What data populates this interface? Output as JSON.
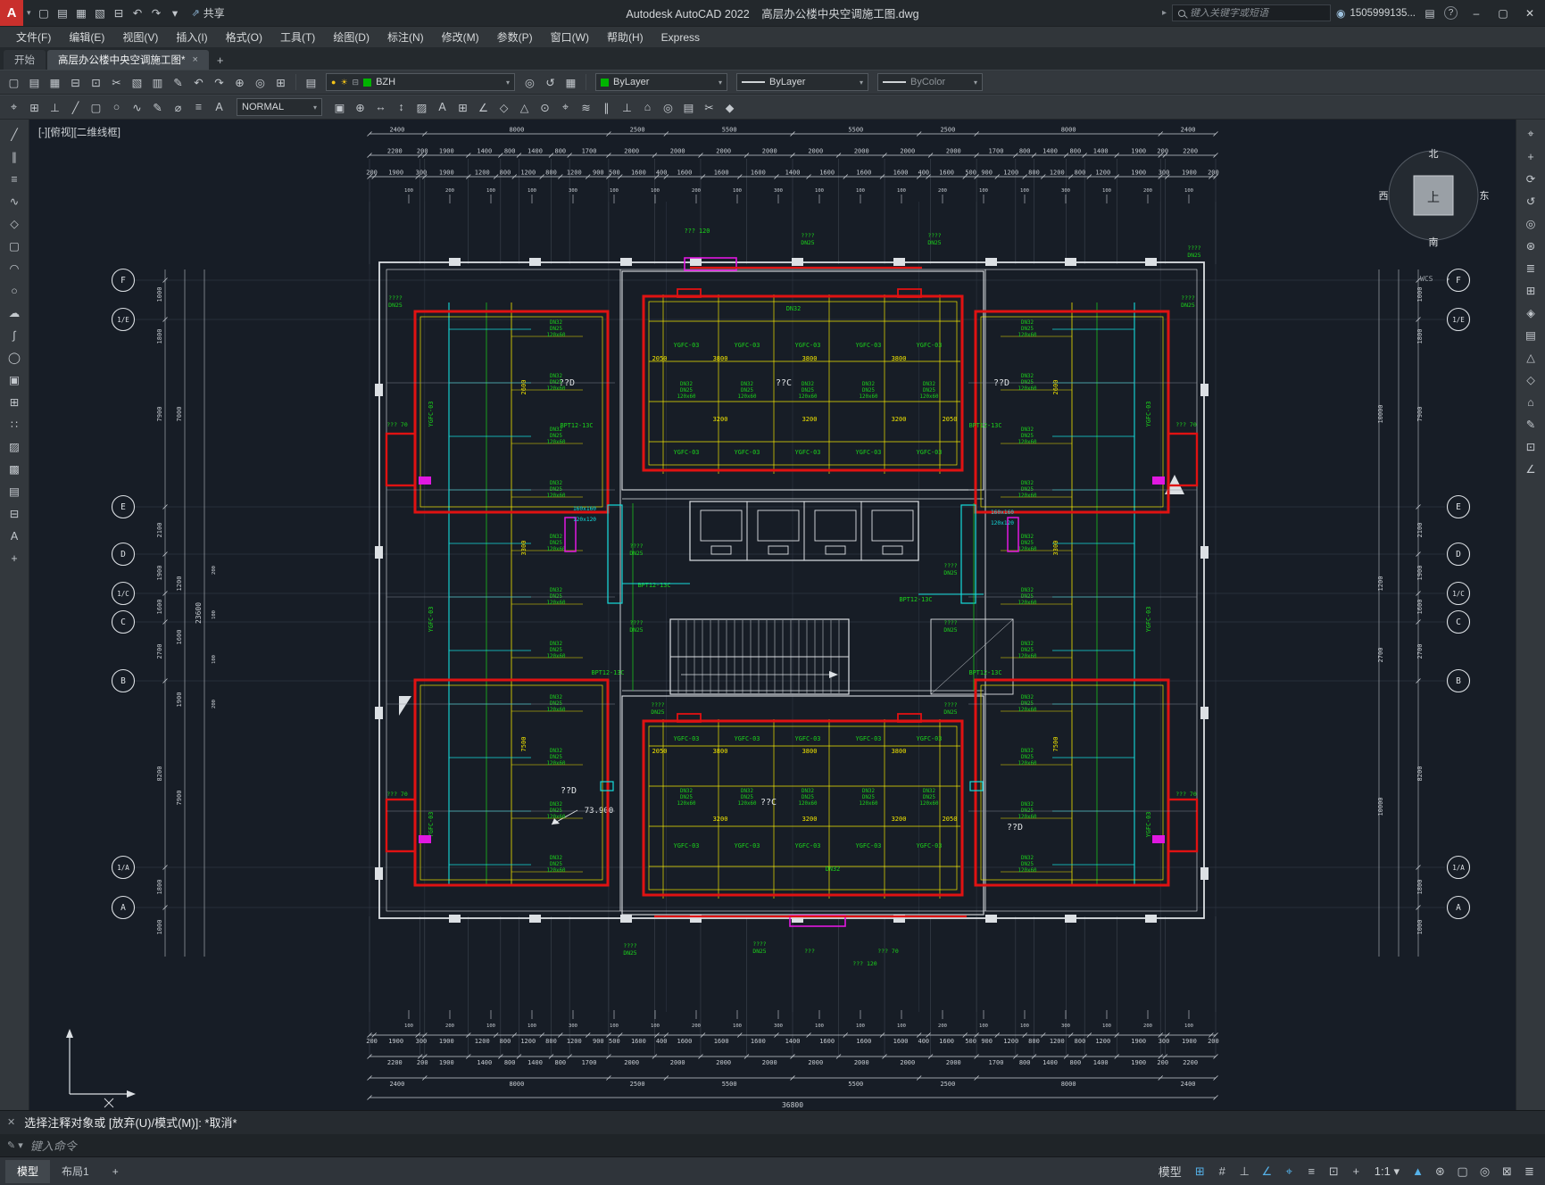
{
  "title_bar": {
    "share": "共享",
    "app_title": "Autodesk AutoCAD 2022",
    "doc_title": "高层办公楼中央空调施工图.dwg",
    "search_placeholder": "键入关键字或短语",
    "account": "1505999135..."
  },
  "menu_items": [
    "文件(F)",
    "编辑(E)",
    "视图(V)",
    "插入(I)",
    "格式(O)",
    "工具(T)",
    "绘图(D)",
    "标注(N)",
    "修改(M)",
    "参数(P)",
    "窗口(W)",
    "帮助(H)",
    "Express"
  ],
  "doc_tabs": {
    "start": "开始",
    "doc": "高层办公楼中央空调施工图*",
    "plus": "+"
  },
  "toolbar": {
    "layer": "BZH",
    "color": "ByLayer",
    "linetype": "ByLayer",
    "lineweight": "ByColor",
    "style": "NORMAL"
  },
  "command_line": {
    "history": "选择注释对象或 [放弃(U)/模式(M)]: *取消*",
    "input": "键入命令"
  },
  "status_bar": {
    "model": "模型",
    "layout1": "布局1",
    "plus": "+"
  },
  "icons": {
    "qat": [
      {
        "n": "new-icon",
        "g": "▢"
      },
      {
        "n": "open-icon",
        "g": "▤"
      },
      {
        "n": "save-icon",
        "g": "▦"
      },
      {
        "n": "saveas-icon",
        "g": "▧"
      },
      {
        "n": "plot-icon",
        "g": "⊟"
      },
      {
        "n": "undo-icon",
        "g": "↶"
      },
      {
        "n": "redo-icon",
        "g": "↷"
      },
      {
        "n": "qat-dropdown-icon",
        "g": "▾"
      }
    ],
    "rowA": [
      {
        "n": "new2-icon",
        "g": "▢"
      },
      {
        "n": "open2-icon",
        "g": "▤"
      },
      {
        "n": "save2-icon",
        "g": "▦"
      },
      {
        "n": "plot2-icon",
        "g": "⊟"
      },
      {
        "n": "preview-icon",
        "g": "⊡"
      },
      {
        "n": "cut-icon",
        "g": "✂"
      },
      {
        "n": "copy-icon",
        "g": "▧"
      },
      {
        "n": "paste-icon",
        "g": "▥"
      },
      {
        "n": "matchprops-icon",
        "g": "✎"
      },
      {
        "n": "undo3-icon",
        "g": "↶"
      },
      {
        "n": "redo3-icon",
        "g": "↷"
      },
      {
        "n": "pan-icon",
        "g": "⊕"
      },
      {
        "n": "zoom-icon",
        "g": "◎"
      },
      {
        "n": "properties-icon",
        "g": "⊞"
      }
    ],
    "layer_pre": [
      {
        "n": "layer-properties-icon",
        "g": "▤"
      }
    ],
    "rowA2": [
      {
        "n": "make-current-icon",
        "g": "◎"
      },
      {
        "n": "layer-previous-icon",
        "g": "↺"
      },
      {
        "n": "layer-state-icon",
        "g": "▦"
      }
    ],
    "rowB_left": [
      {
        "n": "snap-icon",
        "g": "⌖"
      },
      {
        "n": "grid-icon",
        "g": "⊞"
      },
      {
        "n": "ortho-icon",
        "g": "⊥"
      },
      {
        "n": "line-icon",
        "g": "╱"
      },
      {
        "n": "rect-icon",
        "g": "▢"
      },
      {
        "n": "circle-icon",
        "g": "○"
      },
      {
        "n": "spline-icon",
        "g": "∿"
      },
      {
        "n": "edit-icon",
        "g": "✎"
      },
      {
        "n": "diameter-icon",
        "g": "⌀"
      },
      {
        "n": "list-icon",
        "g": "≡"
      },
      {
        "n": "text-icon",
        "g": "A"
      }
    ],
    "rowB_right": [
      {
        "n": "copy2-icon",
        "g": "▣"
      },
      {
        "n": "insert-icon",
        "g": "⊕"
      },
      {
        "n": "stretch-icon",
        "g": "↔"
      },
      {
        "n": "scale-icon",
        "g": "↕"
      },
      {
        "n": "hatch-icon",
        "g": "▨"
      },
      {
        "n": "text2-icon",
        "g": "A"
      },
      {
        "n": "table-icon",
        "g": "⊞"
      },
      {
        "n": "dimension-icon",
        "g": "∠"
      },
      {
        "n": "leader-icon",
        "g": "◇"
      },
      {
        "n": "block-icon",
        "g": "△"
      },
      {
        "n": "point-icon",
        "g": "⊙"
      },
      {
        "n": "osnap2-icon",
        "g": "⌖"
      },
      {
        "n": "polyline2-icon",
        "g": "≋"
      },
      {
        "n": "parallel-icon",
        "g": "∥"
      },
      {
        "n": "perpendicular-icon",
        "g": "⊥"
      },
      {
        "n": "home-icon",
        "g": "⌂"
      },
      {
        "n": "zoom2-icon",
        "g": "◎"
      },
      {
        "n": "props2-icon",
        "g": "▤"
      },
      {
        "n": "trim-icon",
        "g": "✂"
      },
      {
        "n": "erase-icon",
        "g": "◆"
      }
    ],
    "left_col": [
      {
        "n": "line-tool-icon",
        "g": "╱"
      },
      {
        "n": "xline-tool-icon",
        "g": "∥"
      },
      {
        "n": "mline-tool-icon",
        "g": "≡"
      },
      {
        "n": "polyline-tool-icon",
        "g": "∿"
      },
      {
        "n": "polygon-tool-icon",
        "g": "◇"
      },
      {
        "n": "rectangle-tool-icon",
        "g": "▢"
      },
      {
        "n": "arc-tool-icon",
        "g": "◠"
      },
      {
        "n": "circle-tool-icon",
        "g": "○"
      },
      {
        "n": "revcloud-tool-icon",
        "g": "☁"
      },
      {
        "n": "spline-tool-icon",
        "g": "∫"
      },
      {
        "n": "ellipse-tool-icon",
        "g": "◯"
      },
      {
        "n": "insert-block-icon",
        "g": "▣"
      },
      {
        "n": "make-block-icon",
        "g": "⊞"
      },
      {
        "n": "point-tool-icon",
        "g": "∷"
      },
      {
        "n": "hatch-tool-icon",
        "g": "▨"
      },
      {
        "n": "gradient-tool-icon",
        "g": "▩"
      },
      {
        "n": "region-tool-icon",
        "g": "▤"
      },
      {
        "n": "table-tool-icon",
        "g": "⊟"
      },
      {
        "n": "mtext-tool-icon",
        "g": "A"
      },
      {
        "n": "divide-tool-icon",
        "g": "+"
      }
    ],
    "right_col": [
      {
        "n": "measure-icon",
        "g": "⌖"
      },
      {
        "n": "move-icon",
        "g": "+"
      },
      {
        "n": "rotate-icon",
        "g": "⟳"
      },
      {
        "n": "undo2-icon",
        "g": "↺"
      },
      {
        "n": "zoom3-icon",
        "g": "◎"
      },
      {
        "n": "pan2-icon",
        "g": "⊛"
      },
      {
        "n": "layers3-icon",
        "g": "≣"
      },
      {
        "n": "grid2-icon",
        "g": "⊞"
      },
      {
        "n": "gem-icon",
        "g": "◈"
      },
      {
        "n": "sheet-icon",
        "g": "▤"
      },
      {
        "n": "up-icon",
        "g": "△"
      },
      {
        "n": "diamond-icon",
        "g": "◇"
      },
      {
        "n": "home2-icon",
        "g": "⌂"
      },
      {
        "n": "annotate-icon",
        "g": "✎"
      },
      {
        "n": "box-icon",
        "g": "⊡"
      },
      {
        "n": "angle-icon",
        "g": "∠"
      }
    ],
    "status_right": [
      {
        "n": "model-space-button",
        "g": "模型",
        "t": 1
      },
      {
        "n": "grid-toggle-icon",
        "g": "⊞",
        "b": 1
      },
      {
        "n": "snap-toggle-icon",
        "g": "#"
      },
      {
        "n": "ortho-toggle-icon",
        "g": "⊥"
      },
      {
        "n": "polar-toggle-icon",
        "g": "∠",
        "b": 1
      },
      {
        "n": "osnap-toggle-icon",
        "g": "⌖",
        "b": 1
      },
      {
        "n": "lineweight-toggle-icon",
        "g": "≡"
      },
      {
        "n": "transparency-toggle-icon",
        "g": "⊡"
      },
      {
        "n": "dynamic-input-icon",
        "g": "+"
      },
      {
        "n": "scale-display",
        "g": "1:1 ▾",
        "t": 1
      },
      {
        "n": "annotation-scale-icon",
        "g": "▲",
        "b": 1
      },
      {
        "n": "workspace-gear-icon",
        "g": "⊛"
      },
      {
        "n": "units-icon",
        "g": "▢"
      },
      {
        "n": "quick-search-icon",
        "g": "◎"
      },
      {
        "n": "fullscreen-icon",
        "g": "⊠"
      },
      {
        "n": "customize-icon",
        "g": "≣"
      }
    ]
  },
  "drawing": {
    "viewport_label": "[-][俯视][二维线框]",
    "wcs_label": "WCS",
    "compass": {
      "north": "北",
      "south": "南",
      "west": "西",
      "east": "东",
      "center": "上"
    },
    "axis_bubbles": [
      "F",
      "1/E",
      "E",
      "D",
      "1/C",
      "C",
      "B",
      "1/A",
      "A"
    ],
    "top_dims_row1": [
      "2400",
      "8000",
      "2500",
      "5500",
      "5500",
      "2500",
      "8000",
      "2400"
    ],
    "top_dims_row2": [
      "2200",
      "200",
      "1900",
      "1400",
      "800",
      "1400",
      "800",
      "1700",
      "2000",
      "2000",
      "2000",
      "2000",
      "2000",
      "2000",
      "2000",
      "2000",
      "1700",
      "800",
      "1400",
      "800",
      "1400",
      "1900",
      "200",
      "2200"
    ],
    "top_dims_row3": [
      "200",
      "1900",
      "300",
      "1900",
      "1200",
      "800",
      "1200",
      "800",
      "1200",
      "900",
      "500",
      "1600",
      "400",
      "1600",
      "1600",
      "1600",
      "1400",
      "1600",
      "1600",
      "1600",
      "400",
      "1600",
      "500",
      "900",
      "1200",
      "800",
      "1200",
      "800",
      "1200",
      "1900",
      "300",
      "1900",
      "200"
    ],
    "tiny_dims": [
      "100",
      "200",
      "100",
      "100",
      "300",
      "100",
      "100",
      "200",
      "100",
      "300",
      "100",
      "100",
      "100",
      "200",
      "100",
      "100",
      "300",
      "100",
      "200",
      "100"
    ],
    "bottom_total": "36800",
    "left_dims_outer": [
      "1000",
      "1800",
      "7900",
      "2100",
      "1900",
      "1600",
      "2700",
      "8200",
      "1800",
      "1000"
    ],
    "left_dims_inner": [
      "7000",
      "1200",
      "1600",
      "1900",
      "7900"
    ],
    "left_tiny": [
      "200",
      "100",
      "100",
      "200"
    ],
    "left_total": "23600",
    "right_dims_inner": [
      "10000",
      "1200",
      "2700",
      "10000"
    ],
    "labels": {
      "fcu": "YGFC-03",
      "pump": "BPT12-13C",
      "dn25": "DN25",
      "dn32": "DN32",
      "size160": "160x160",
      "size120": "120x120",
      "q4": "????",
      "q3": "???",
      "q70": "??? 70",
      "q120": "??? 120",
      "room_c": "??C",
      "room_d": "??D",
      "elevation": "73.900",
      "stack": [
        "DN32",
        "DN25",
        "120x60"
      ]
    },
    "yellow_dims": {
      "d3800": "3800",
      "d3200": "3200",
      "d2050": "2050",
      "d2600": "2600",
      "d3300": "3300",
      "d7500": "7500"
    }
  }
}
